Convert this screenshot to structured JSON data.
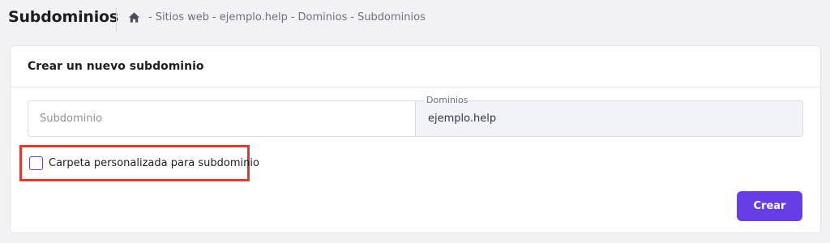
{
  "header": {
    "title": "Subdominios",
    "breadcrumb": [
      "Sitios web",
      "ejemplo.help",
      "Dominios",
      "Subdominios"
    ],
    "separator": "-"
  },
  "form": {
    "title": "Crear un nuevo subdominio",
    "subdomain_placeholder": "Subdominio",
    "subdomain_value": "",
    "domain_label": "Dominios",
    "domain_value": "ejemplo.help",
    "checkbox_label": "Carpeta personalizada para subdominio",
    "checkbox_checked": false,
    "submit_label": "Crear"
  },
  "colors": {
    "accent": "#673de6",
    "highlight": "#e5372c",
    "background": "#f2f2f5"
  },
  "icons": [
    "home-icon"
  ]
}
